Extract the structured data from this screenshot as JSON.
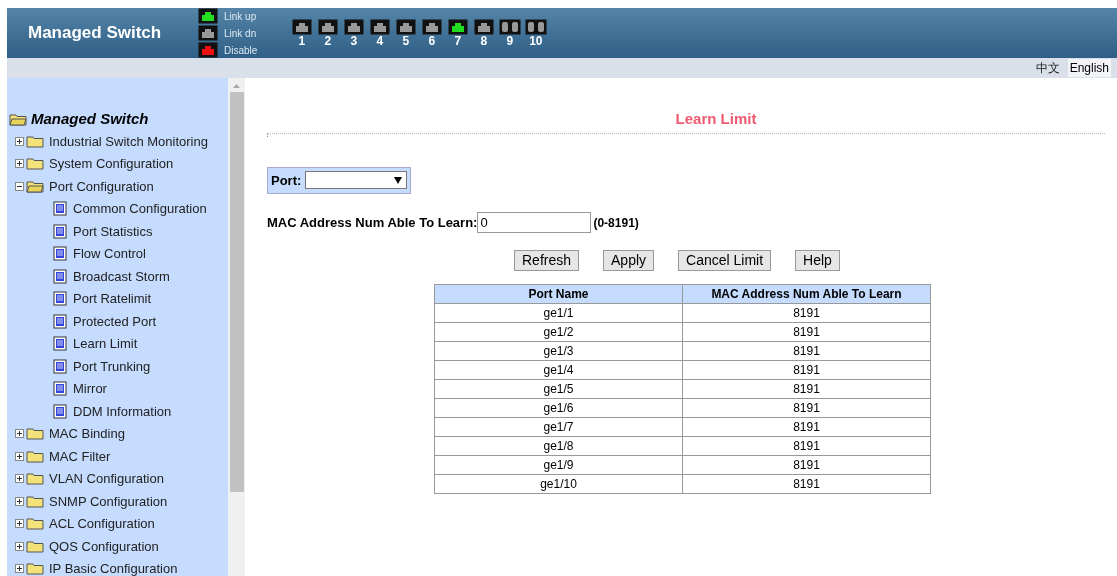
{
  "header": {
    "title": "Managed Switch",
    "legend": [
      {
        "label": "Link up",
        "color": "#22dd22"
      },
      {
        "label": "Link dn",
        "color": "#999999"
      },
      {
        "label": "Disable",
        "color": "#ee1111"
      }
    ],
    "ports": [
      {
        "label": "1",
        "color": "#999999",
        "kind": "copper"
      },
      {
        "label": "2",
        "color": "#999999",
        "kind": "copper"
      },
      {
        "label": "3",
        "color": "#999999",
        "kind": "copper"
      },
      {
        "label": "4",
        "color": "#999999",
        "kind": "copper"
      },
      {
        "label": "5",
        "color": "#999999",
        "kind": "copper"
      },
      {
        "label": "6",
        "color": "#999999",
        "kind": "copper"
      },
      {
        "label": "7",
        "color": "#22dd22",
        "kind": "copper"
      },
      {
        "label": "8",
        "color": "#999999",
        "kind": "copper"
      },
      {
        "label": "9",
        "color": "#999999",
        "kind": "fiber"
      },
      {
        "label": "10",
        "color": "#999999",
        "kind": "fiber"
      }
    ]
  },
  "languages": [
    {
      "label": "中文",
      "selected": false
    },
    {
      "label": "English",
      "selected": true
    }
  ],
  "sidebar": {
    "root": "Managed Switch",
    "items": [
      {
        "label": "Industrial Switch Monitoring",
        "expanded": false
      },
      {
        "label": "System Configuration",
        "expanded": false
      },
      {
        "label": "Port Configuration",
        "expanded": true,
        "children": [
          {
            "label": "Common Configuration"
          },
          {
            "label": "Port Statistics"
          },
          {
            "label": "Flow Control"
          },
          {
            "label": "Broadcast Storm"
          },
          {
            "label": "Port Ratelimit"
          },
          {
            "label": "Protected Port"
          },
          {
            "label": "Learn Limit"
          },
          {
            "label": "Port Trunking"
          },
          {
            "label": "Mirror"
          },
          {
            "label": "DDM Information"
          }
        ]
      },
      {
        "label": "MAC Binding",
        "expanded": false
      },
      {
        "label": "MAC Filter",
        "expanded": false
      },
      {
        "label": "VLAN Configuration",
        "expanded": false
      },
      {
        "label": "SNMP Configuration",
        "expanded": false
      },
      {
        "label": "ACL Configuration",
        "expanded": false
      },
      {
        "label": "QOS Configuration",
        "expanded": false
      },
      {
        "label": "IP Basic Configuration",
        "expanded": false
      }
    ]
  },
  "content": {
    "title": "Learn Limit",
    "port_label": "Port:",
    "mac_label": "MAC Address Num Able To Learn:",
    "mac_value": "0",
    "mac_range": "(0-8191)",
    "buttons": [
      "Refresh",
      "Apply",
      "Cancel Limit",
      "Help"
    ],
    "table": {
      "columns": [
        "Port Name",
        "MAC Address Num Able To Learn"
      ],
      "rows": [
        [
          "ge1/1",
          "8191"
        ],
        [
          "ge1/2",
          "8191"
        ],
        [
          "ge1/3",
          "8191"
        ],
        [
          "ge1/4",
          "8191"
        ],
        [
          "ge1/5",
          "8191"
        ],
        [
          "ge1/6",
          "8191"
        ],
        [
          "ge1/7",
          "8191"
        ],
        [
          "ge1/8",
          "8191"
        ],
        [
          "ge1/9",
          "8191"
        ],
        [
          "ge1/10",
          "8191"
        ]
      ]
    }
  }
}
